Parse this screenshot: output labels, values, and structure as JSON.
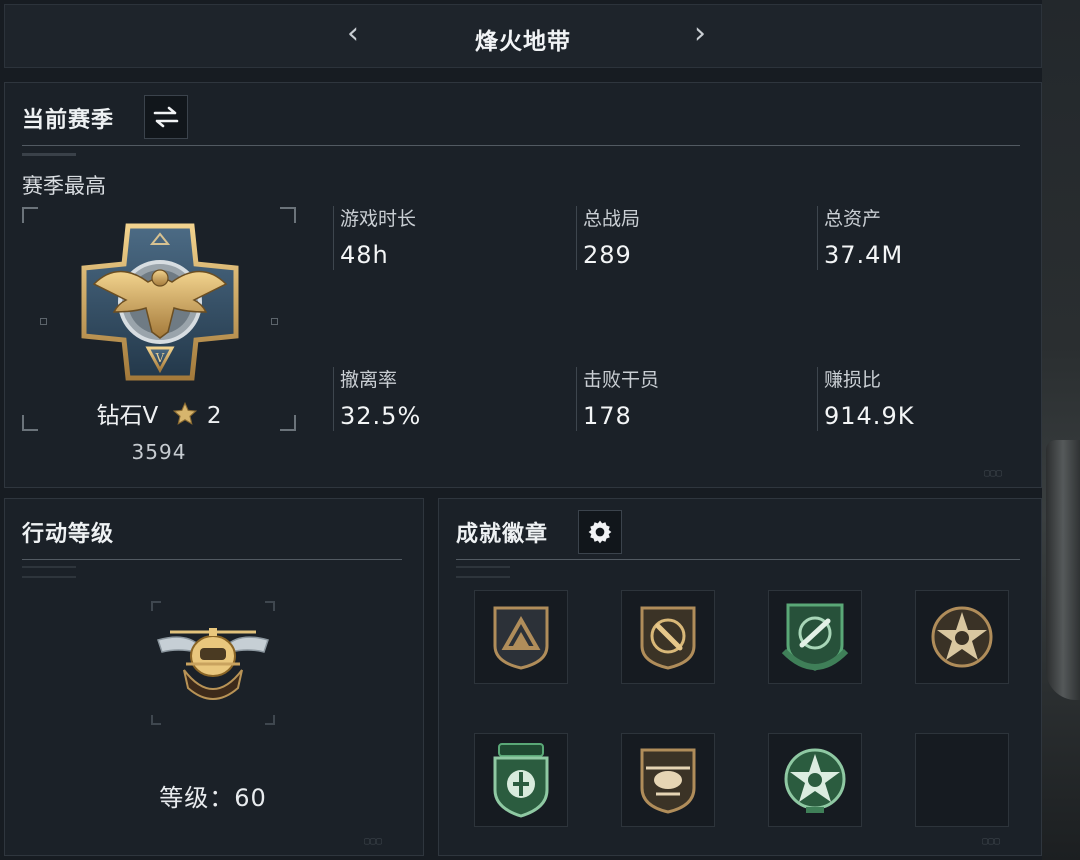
{
  "header": {
    "title": "烽火地带",
    "prev_icon": "chevron-left-icon",
    "next_icon": "chevron-right-icon"
  },
  "season": {
    "title": "当前赛季",
    "switch_icon": "swap-arrows-icon",
    "subtitle": "赛季最高",
    "rank": {
      "name": "钻石V",
      "stars": "2",
      "points": "3594",
      "emblem_icon": "diamond-eagle-emblem-icon"
    },
    "stats": [
      {
        "label": "游戏时长",
        "value": "48h"
      },
      {
        "label": "总战局",
        "value": "289"
      },
      {
        "label": "总资产",
        "value": "37.4M"
      },
      {
        "label": "撤离率",
        "value": "32.5%"
      },
      {
        "label": "击败干员",
        "value": "178"
      },
      {
        "label": "赚损比",
        "value": "914.9K"
      }
    ]
  },
  "level": {
    "title": "行动等级",
    "label": "等级：60",
    "emblem_icon": "helicopter-wings-emblem-icon"
  },
  "badges": {
    "title": "成就徽章",
    "settings_icon": "gear-icon",
    "items": [
      {
        "icon": "triangle-shield-badge-icon",
        "color": "#b08d5a"
      },
      {
        "icon": "knife-shield-badge-icon",
        "color": "#b08d5a"
      },
      {
        "icon": "rocket-shield-badge-icon",
        "color": "#4f9a6a"
      },
      {
        "icon": "star-skull-badge-icon",
        "color": "#b08d5a"
      },
      {
        "icon": "medkit-shield-badge-icon",
        "color": "#4f9a6a"
      },
      {
        "icon": "helicopter-shield-badge-icon",
        "color": "#b08d5a"
      },
      {
        "icon": "star-skull-green-badge-icon",
        "color": "#4f9a6a"
      },
      {
        "icon": "empty-slot",
        "color": ""
      }
    ]
  },
  "colors": {
    "gold": "#c9a463",
    "green": "#4f9a6a",
    "panel": "#1b2128"
  }
}
